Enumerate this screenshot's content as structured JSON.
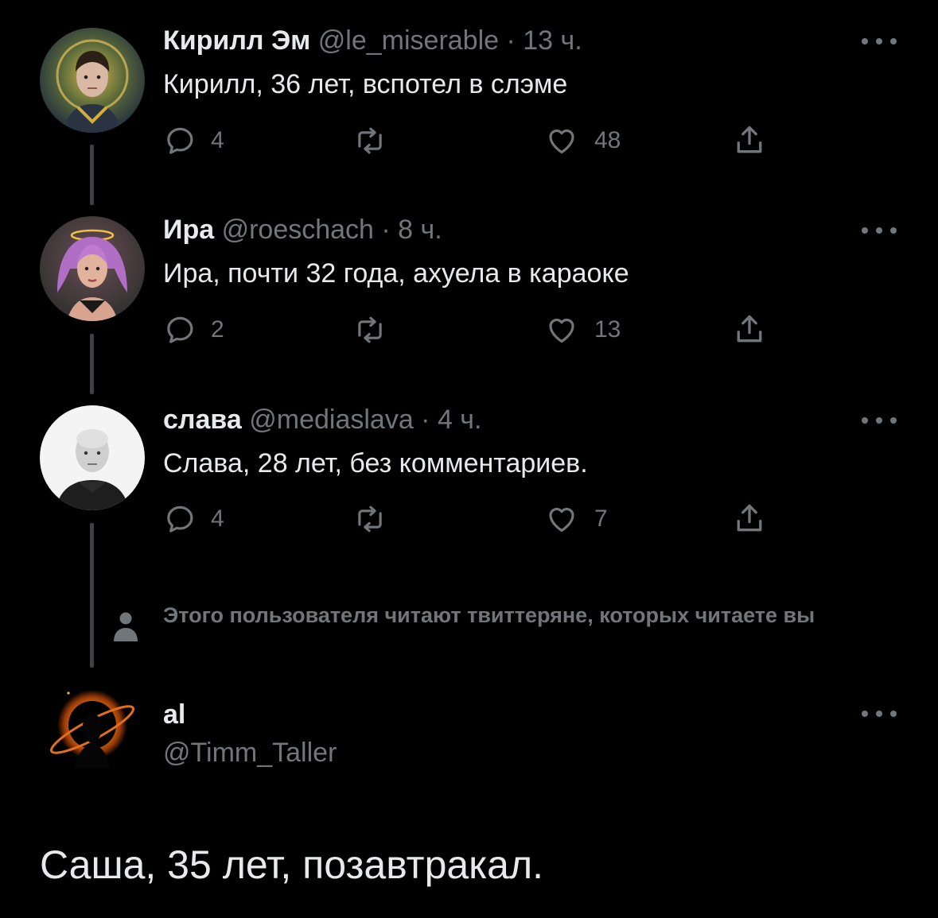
{
  "tweets": [
    {
      "name": "Кирилл Эм",
      "handle_time": "@le_miserable · 13 ч.",
      "text": "Кирилл, 36 лет, вспотел в слэме",
      "replies": "4",
      "retweets": "",
      "likes": "48"
    },
    {
      "name": "Ира",
      "handle_time": "@roeschach · 8 ч.",
      "text": "Ира, почти 32 года, ахуела в караоке",
      "replies": "2",
      "retweets": "",
      "likes": "13"
    },
    {
      "name": "слава",
      "handle_time": "@mediaslava · 4 ч.",
      "text": "Слава, 28 лет, без комментариев.",
      "replies": "4",
      "retweets": "",
      "likes": "7"
    }
  ],
  "social_context": "Этого пользователя читают твиттеряне, которых читаете вы",
  "main_tweet": {
    "name": "al",
    "handle": "@Timm_Taller",
    "text": "Саша, 35 лет, позавтракал."
  },
  "icons": {
    "reply": "reply-icon",
    "retweet": "retweet-icon",
    "like": "heart-icon",
    "share": "share-icon",
    "more": "more-icon",
    "person": "person-icon"
  },
  "colors": {
    "background": "#000000",
    "text": "#e7e9ea",
    "secondary": "#71767b",
    "thread_line": "#3e4144"
  }
}
